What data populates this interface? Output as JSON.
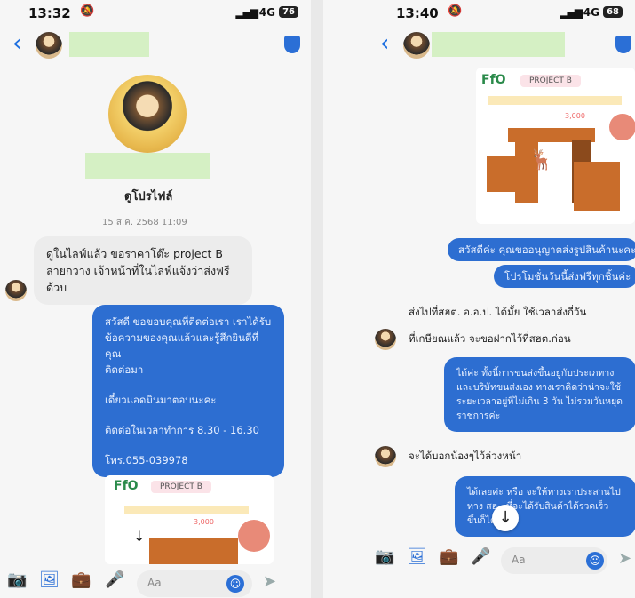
{
  "left": {
    "status": {
      "time": "13:32",
      "net": "4G",
      "battery": "76"
    },
    "profile_label": "ดูโปรไฟล์",
    "date": "15 ส.ค. 2568 11:09",
    "incoming": "ดูในไลฟ์แล้ว ขอราคาโต๊ะ project B ลายกวาง เจ้าหน้าที่ในไลฟ์แจ้งว่าส่งฟรีด้วบ",
    "outgoing_lines": [
      "สวัสดี ขอขอบคุณที่ติดต่อเรา เราได้รับ",
      "ข้อความของคุณแล้วและรู้สึกยินดีที่คุณ",
      "ติดต่อมา",
      "",
      "เดี๋ยวแอดมินมาตอบนะคะ",
      "",
      "ติดต่อในเวลาทำการ 8.30 - 16.30",
      "",
      "โทร.055-039978"
    ],
    "card": {
      "logo": "FfO",
      "title": "PROJECT B",
      "price": "3,000"
    },
    "input_placeholder": "Aa"
  },
  "right": {
    "status": {
      "time": "13:40",
      "net": "4G",
      "battery": "68"
    },
    "card": {
      "logo": "FfO",
      "title": "PROJECT B",
      "price": "3,000"
    },
    "out1": "สวัสดีค่ะ คุณขออนุญาตส่งรูปสินค้านะคะ",
    "out2": "โปรโมชั่นวันนี้ส่งฟรีทุกชิ้นค่ะ",
    "in1": "ส่งไปที่สฮต. อ.อ.ป. ได้มั้ย ใช้เวลาส่งกี่วัน",
    "in2": "ที่เกษียณแล้ว จะขอฝากไว้ที่สฮต.ก่อน",
    "out3_lines": [
      "ได้ค่ะ ทั้งนี้การขนส่งขึ้นอยู่กับประเภทาง",
      "และบริษัทขนส่งเอง ทางเราคิดว่าน่าจะใช้",
      "ระยะเวลาอยู่ที่ไม่เกิน 3 วัน ไม่รวมวันหยุด",
      "ราชการค่ะ"
    ],
    "in3": "จะได้บอกน้องๆไว้ล่วงหน้า",
    "out4_lines": [
      "ได้เลยค่ะ หรือ จะให้ทางเราประสานไป",
      "ทาง สฮ...ที่จะได้รับสินค้าได้รวดเร็ว",
      "ขึ้นก็ได้"
    ],
    "input_placeholder": "Aa"
  }
}
